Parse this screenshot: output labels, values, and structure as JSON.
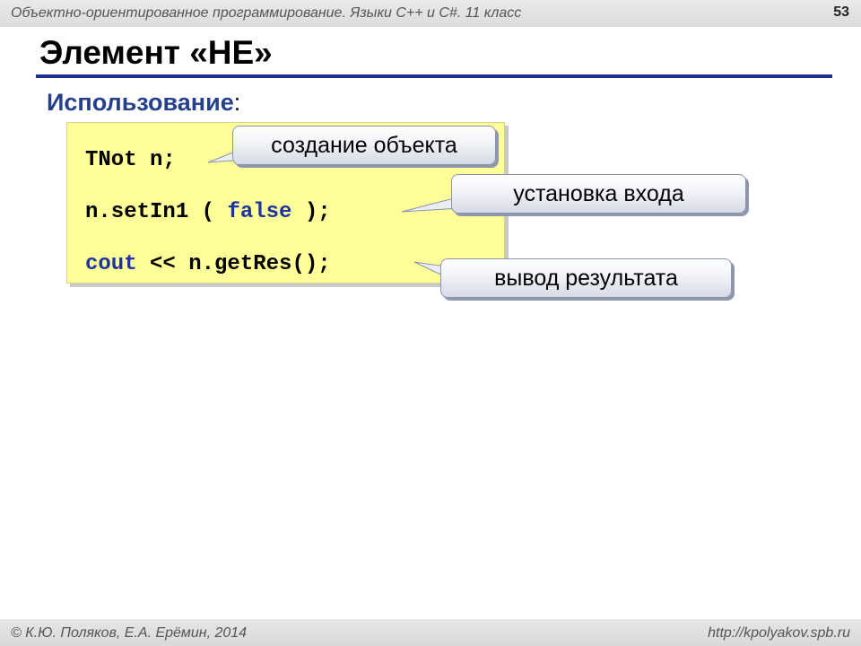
{
  "header": {
    "course_title": "Объектно-ориентированное программирование. Языки C++ и C#. 11 класс",
    "slide_number": "53"
  },
  "slide": {
    "title": "Элемент «НЕ»",
    "usage_label": "Использование",
    "usage_colon": ":"
  },
  "code": {
    "line1": "TNot n;",
    "line2_pre": "n.setIn1 ( ",
    "line2_kw": "false",
    "line2_post": " );",
    "line3_kw": "cout",
    "line3_post": " << n.getRes();"
  },
  "callouts": {
    "create": "создание объекта",
    "set_input": "установка входа",
    "output": "вывод результата"
  },
  "footer": {
    "authors": "© К.Ю. Поляков, Е.А. Ерёмин, 2014",
    "url": "http://kpolyakov.spb.ru"
  },
  "colors": {
    "title_rule": "#1e2f8a",
    "keyword": "#1f33a0",
    "code_background": "#ffff9a"
  }
}
